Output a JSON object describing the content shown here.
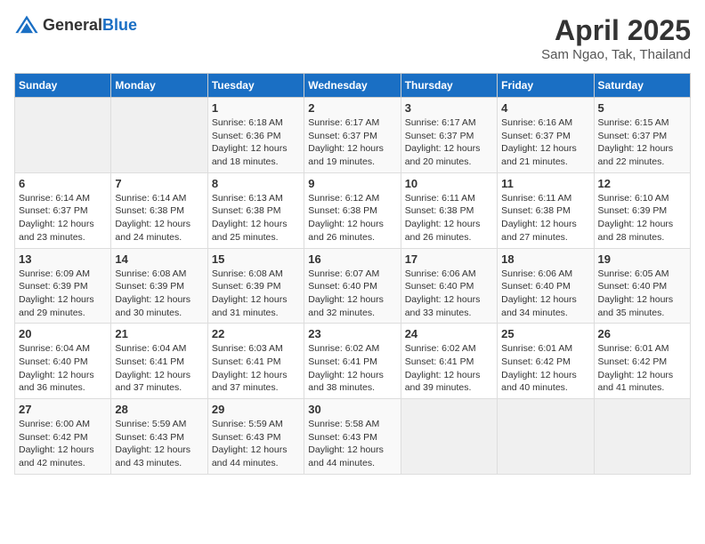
{
  "header": {
    "logo_general": "General",
    "logo_blue": "Blue",
    "title": "April 2025",
    "subtitle": "Sam Ngao, Tak, Thailand"
  },
  "weekdays": [
    "Sunday",
    "Monday",
    "Tuesday",
    "Wednesday",
    "Thursday",
    "Friday",
    "Saturday"
  ],
  "weeks": [
    [
      {
        "day": "",
        "sunrise": "",
        "sunset": "",
        "daylight": ""
      },
      {
        "day": "",
        "sunrise": "",
        "sunset": "",
        "daylight": ""
      },
      {
        "day": "1",
        "sunrise": "Sunrise: 6:18 AM",
        "sunset": "Sunset: 6:36 PM",
        "daylight": "Daylight: 12 hours and 18 minutes."
      },
      {
        "day": "2",
        "sunrise": "Sunrise: 6:17 AM",
        "sunset": "Sunset: 6:37 PM",
        "daylight": "Daylight: 12 hours and 19 minutes."
      },
      {
        "day": "3",
        "sunrise": "Sunrise: 6:17 AM",
        "sunset": "Sunset: 6:37 PM",
        "daylight": "Daylight: 12 hours and 20 minutes."
      },
      {
        "day": "4",
        "sunrise": "Sunrise: 6:16 AM",
        "sunset": "Sunset: 6:37 PM",
        "daylight": "Daylight: 12 hours and 21 minutes."
      },
      {
        "day": "5",
        "sunrise": "Sunrise: 6:15 AM",
        "sunset": "Sunset: 6:37 PM",
        "daylight": "Daylight: 12 hours and 22 minutes."
      }
    ],
    [
      {
        "day": "6",
        "sunrise": "Sunrise: 6:14 AM",
        "sunset": "Sunset: 6:37 PM",
        "daylight": "Daylight: 12 hours and 23 minutes."
      },
      {
        "day": "7",
        "sunrise": "Sunrise: 6:14 AM",
        "sunset": "Sunset: 6:38 PM",
        "daylight": "Daylight: 12 hours and 24 minutes."
      },
      {
        "day": "8",
        "sunrise": "Sunrise: 6:13 AM",
        "sunset": "Sunset: 6:38 PM",
        "daylight": "Daylight: 12 hours and 25 minutes."
      },
      {
        "day": "9",
        "sunrise": "Sunrise: 6:12 AM",
        "sunset": "Sunset: 6:38 PM",
        "daylight": "Daylight: 12 hours and 26 minutes."
      },
      {
        "day": "10",
        "sunrise": "Sunrise: 6:11 AM",
        "sunset": "Sunset: 6:38 PM",
        "daylight": "Daylight: 12 hours and 26 minutes."
      },
      {
        "day": "11",
        "sunrise": "Sunrise: 6:11 AM",
        "sunset": "Sunset: 6:38 PM",
        "daylight": "Daylight: 12 hours and 27 minutes."
      },
      {
        "day": "12",
        "sunrise": "Sunrise: 6:10 AM",
        "sunset": "Sunset: 6:39 PM",
        "daylight": "Daylight: 12 hours and 28 minutes."
      }
    ],
    [
      {
        "day": "13",
        "sunrise": "Sunrise: 6:09 AM",
        "sunset": "Sunset: 6:39 PM",
        "daylight": "Daylight: 12 hours and 29 minutes."
      },
      {
        "day": "14",
        "sunrise": "Sunrise: 6:08 AM",
        "sunset": "Sunset: 6:39 PM",
        "daylight": "Daylight: 12 hours and 30 minutes."
      },
      {
        "day": "15",
        "sunrise": "Sunrise: 6:08 AM",
        "sunset": "Sunset: 6:39 PM",
        "daylight": "Daylight: 12 hours and 31 minutes."
      },
      {
        "day": "16",
        "sunrise": "Sunrise: 6:07 AM",
        "sunset": "Sunset: 6:40 PM",
        "daylight": "Daylight: 12 hours and 32 minutes."
      },
      {
        "day": "17",
        "sunrise": "Sunrise: 6:06 AM",
        "sunset": "Sunset: 6:40 PM",
        "daylight": "Daylight: 12 hours and 33 minutes."
      },
      {
        "day": "18",
        "sunrise": "Sunrise: 6:06 AM",
        "sunset": "Sunset: 6:40 PM",
        "daylight": "Daylight: 12 hours and 34 minutes."
      },
      {
        "day": "19",
        "sunrise": "Sunrise: 6:05 AM",
        "sunset": "Sunset: 6:40 PM",
        "daylight": "Daylight: 12 hours and 35 minutes."
      }
    ],
    [
      {
        "day": "20",
        "sunrise": "Sunrise: 6:04 AM",
        "sunset": "Sunset: 6:40 PM",
        "daylight": "Daylight: 12 hours and 36 minutes."
      },
      {
        "day": "21",
        "sunrise": "Sunrise: 6:04 AM",
        "sunset": "Sunset: 6:41 PM",
        "daylight": "Daylight: 12 hours and 37 minutes."
      },
      {
        "day": "22",
        "sunrise": "Sunrise: 6:03 AM",
        "sunset": "Sunset: 6:41 PM",
        "daylight": "Daylight: 12 hours and 37 minutes."
      },
      {
        "day": "23",
        "sunrise": "Sunrise: 6:02 AM",
        "sunset": "Sunset: 6:41 PM",
        "daylight": "Daylight: 12 hours and 38 minutes."
      },
      {
        "day": "24",
        "sunrise": "Sunrise: 6:02 AM",
        "sunset": "Sunset: 6:41 PM",
        "daylight": "Daylight: 12 hours and 39 minutes."
      },
      {
        "day": "25",
        "sunrise": "Sunrise: 6:01 AM",
        "sunset": "Sunset: 6:42 PM",
        "daylight": "Daylight: 12 hours and 40 minutes."
      },
      {
        "day": "26",
        "sunrise": "Sunrise: 6:01 AM",
        "sunset": "Sunset: 6:42 PM",
        "daylight": "Daylight: 12 hours and 41 minutes."
      }
    ],
    [
      {
        "day": "27",
        "sunrise": "Sunrise: 6:00 AM",
        "sunset": "Sunset: 6:42 PM",
        "daylight": "Daylight: 12 hours and 42 minutes."
      },
      {
        "day": "28",
        "sunrise": "Sunrise: 5:59 AM",
        "sunset": "Sunset: 6:43 PM",
        "daylight": "Daylight: 12 hours and 43 minutes."
      },
      {
        "day": "29",
        "sunrise": "Sunrise: 5:59 AM",
        "sunset": "Sunset: 6:43 PM",
        "daylight": "Daylight: 12 hours and 44 minutes."
      },
      {
        "day": "30",
        "sunrise": "Sunrise: 5:58 AM",
        "sunset": "Sunset: 6:43 PM",
        "daylight": "Daylight: 12 hours and 44 minutes."
      },
      {
        "day": "",
        "sunrise": "",
        "sunset": "",
        "daylight": ""
      },
      {
        "day": "",
        "sunrise": "",
        "sunset": "",
        "daylight": ""
      },
      {
        "day": "",
        "sunrise": "",
        "sunset": "",
        "daylight": ""
      }
    ]
  ]
}
